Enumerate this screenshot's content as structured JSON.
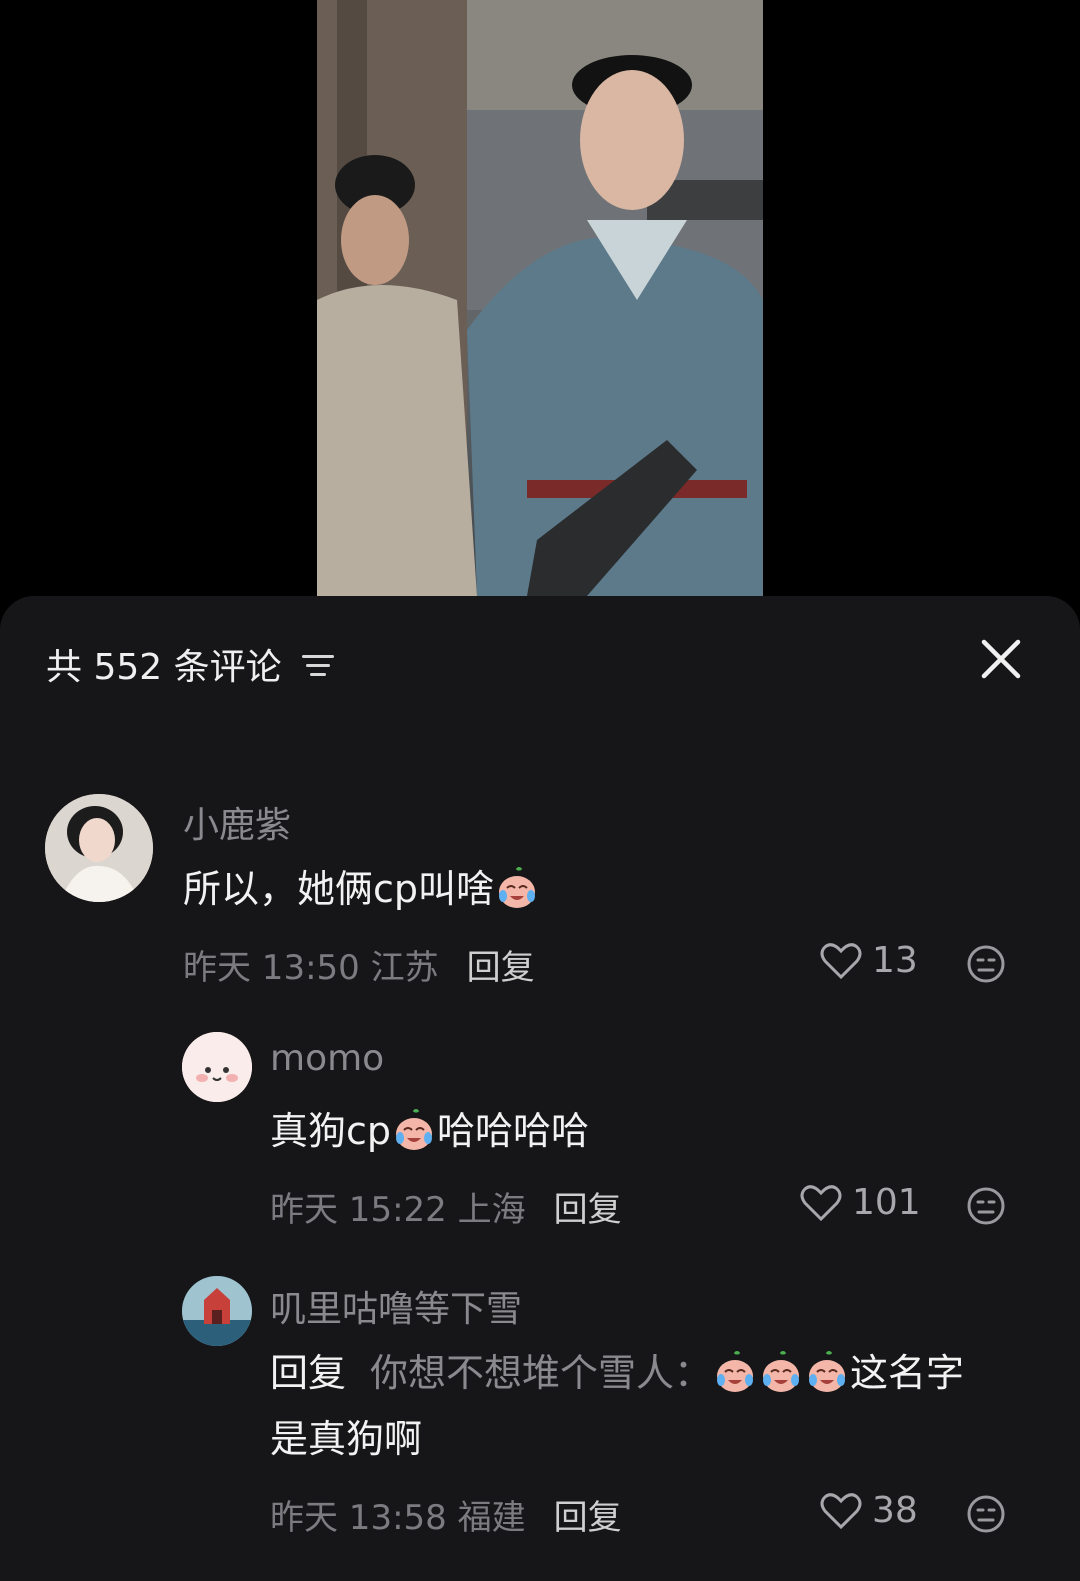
{
  "header": {
    "title": "共 552 条评论"
  },
  "comments": [
    {
      "user": "小鹿紫",
      "text": "所以，她俩cp叫啥",
      "time": "昨天 13:50 江苏",
      "reply_label": "回复",
      "likes": "13"
    },
    {
      "user": "momo",
      "text_prefix": "真狗cp",
      "text_suffix": "哈哈哈哈",
      "time": "昨天 15:22 上海",
      "reply_label": "回复",
      "likes": "101"
    },
    {
      "user": "叽里咕噜等下雪",
      "reply_word": "回复",
      "quoted_user": "你想不想堆个雪人：",
      "text_line1_end": "这名字",
      "text_line2": "是真狗啊",
      "time": "昨天 13:58 福建",
      "reply_label": "回复",
      "likes": "38"
    }
  ],
  "icons": [
    "filter-icon",
    "close-icon",
    "heart-icon",
    "emoji-react-icon",
    "crying-laugh-emoji"
  ]
}
